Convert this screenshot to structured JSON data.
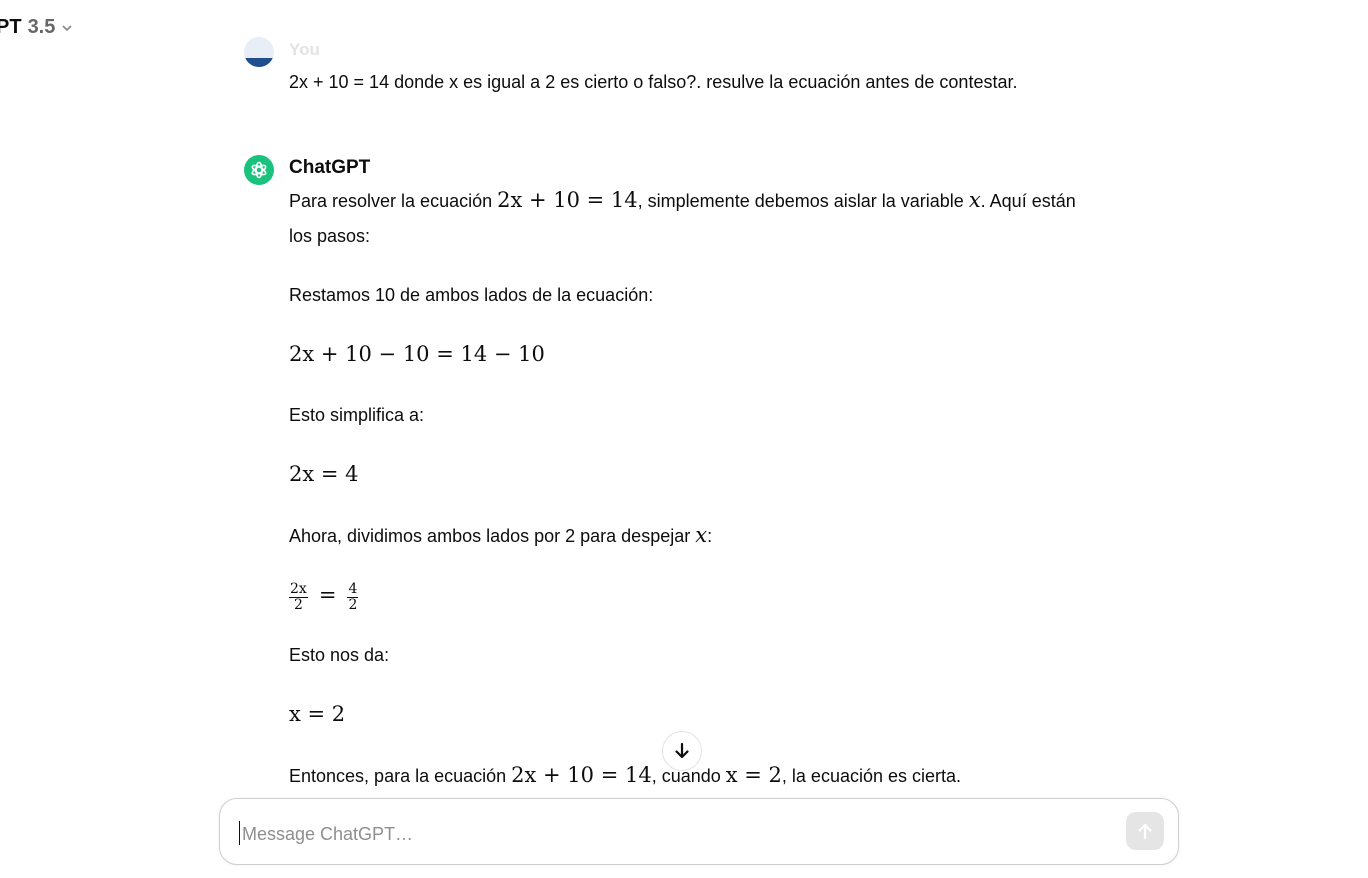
{
  "header": {
    "model_prefix": "PT",
    "model_version": "3.5",
    "chevron_icon": "chevron-down-icon"
  },
  "user_turn": {
    "sender": "You",
    "message": "2x + 10 = 14 donde x es igual a 2 es cierto o falso?. resulve la ecuación antes de contestar."
  },
  "assistant_turn": {
    "sender": "ChatGPT",
    "p1_a": "Para resolver la ecuación ",
    "p1_math": "2x + 10 = 14",
    "p1_b": ", simplemente debemos aislar la variable ",
    "p1_var": "x",
    "p1_c": ". Aquí están",
    "p1_d": "los pasos:",
    "step1_text": "Restamos 10 de ambos lados de la ecuación:",
    "step1_math": "2x + 10 − 10 = 14 − 10",
    "step2_text": "Esto simplifica a:",
    "step2_math": "2x = 4",
    "step3_a": "Ahora, dividimos ambos lados por 2 para despejar ",
    "step3_var": "x",
    "step3_b": ":",
    "frac_left_num": "2x",
    "frac_left_den": "2",
    "frac_eq": "=",
    "frac_right_num": "4",
    "frac_right_den": "2",
    "step4_text": "Esto nos da:",
    "step4_math": "x = 2",
    "concl_a": "Entonces, para la ecuación ",
    "concl_math1": "2x + 10 = 14",
    "concl_b": ", cuando ",
    "concl_math2": "x = 2",
    "concl_c": ", la ecuación es cierta."
  },
  "composer": {
    "placeholder": "Message ChatGPT…",
    "value": ""
  },
  "icons": {
    "scroll_down": "arrow-down-icon",
    "send": "arrow-up-icon",
    "assistant": "openai-logo-icon"
  },
  "colors": {
    "assistant_avatar": "#19c37d",
    "send_disabled": "#e5e5e5"
  }
}
